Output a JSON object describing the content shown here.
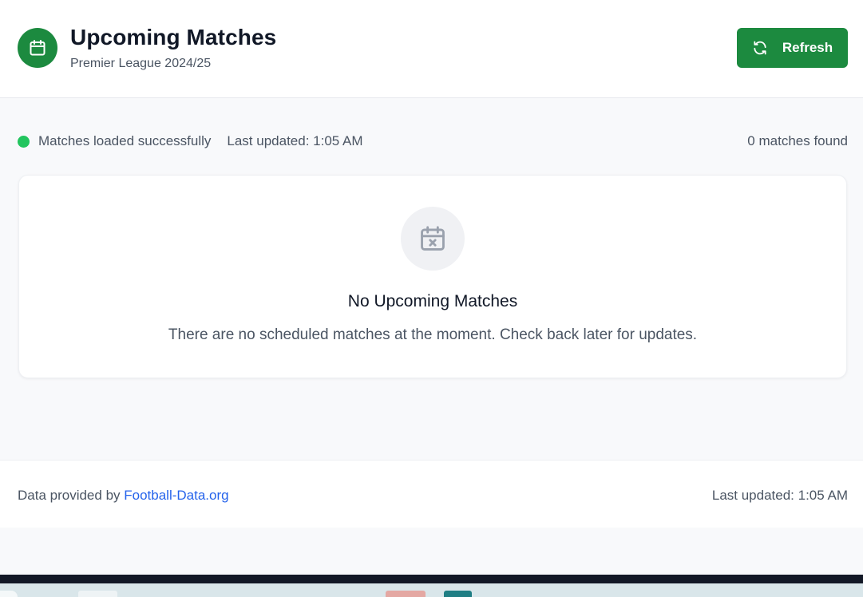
{
  "header": {
    "title": "Upcoming Matches",
    "subtitle": "Premier League 2024/25",
    "refresh_label": "Refresh",
    "brand_icon": "calendar-icon",
    "refresh_icon": "refresh-icon"
  },
  "status": {
    "message": "Matches loaded successfully",
    "last_updated": "Last updated: 1:05 AM",
    "matches_count": "0 matches found",
    "status_color": "#22c55e"
  },
  "empty_state": {
    "icon": "calendar-x-icon",
    "title": "No Upcoming Matches",
    "description": "There are no scheduled matches at the moment. Check back later for updates."
  },
  "footer": {
    "provided_prefix": "Data provided by ",
    "provider_link": "Football-Data.org",
    "last_updated": "Last updated: 1:05 AM"
  },
  "colors": {
    "accent": "#1c8a3f",
    "link": "#2563eb",
    "background": "#f8f9fb"
  }
}
